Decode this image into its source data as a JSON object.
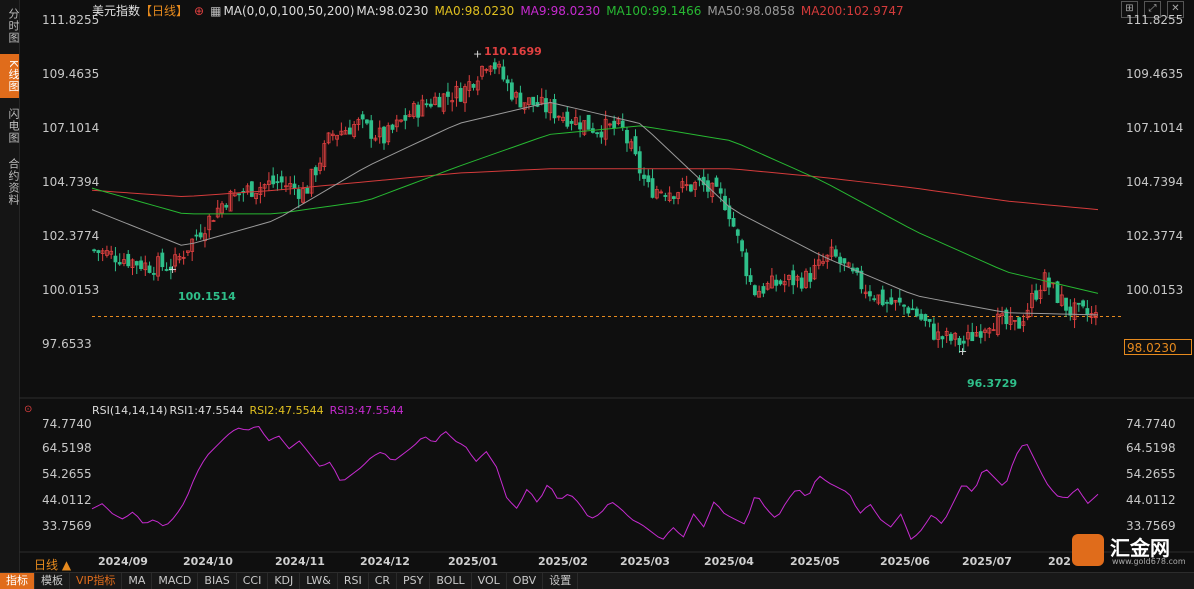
{
  "side_tabs": [
    "分时图",
    "K线图",
    "闪电图",
    "合约资料"
  ],
  "active_tab": 1,
  "header": {
    "name": "美元指数",
    "period": "【日线】",
    "ma_settings": "MA(0,0,0,100,50,200)",
    "ma_value": "MA:98.0230",
    "ma0": "MA0:98.0230",
    "ma9": "MA9:98.0230",
    "ma100": "MA100:99.1466",
    "ma50": "MA50:98.0858",
    "ma200": "MA200:102.9747"
  },
  "colors": {
    "up": "#e04040",
    "down": "#2fbf8a",
    "ma50": "#9a9a9a",
    "ma100": "#27b832",
    "ma200": "#d43b3b",
    "rsi": "#c72bd0",
    "accent": "#e68a1e"
  },
  "price_axis": [
    "111.8255",
    "109.4635",
    "107.1014",
    "104.7394",
    "102.3774",
    "100.0153",
    "97.6533"
  ],
  "current_price": "98.0230",
  "annotations": {
    "high": "110.1699",
    "low1": "100.1514",
    "low2": "96.3729"
  },
  "rsi": {
    "legend": "RSI(14,14,14)",
    "rsi1": "RSI1:47.5544",
    "rsi2": "RSI2:47.5544",
    "rsi3": "RSI3:47.5544",
    "axis": [
      "74.7740",
      "64.5198",
      "54.2655",
      "44.0112",
      "33.7569"
    ]
  },
  "x_axis": [
    "2024/09",
    "2024/10",
    "2024/11",
    "2024/12",
    "2025/01",
    "2025/02",
    "2025/03",
    "2025/04",
    "2025/05",
    "2025/06",
    "2025/07",
    "202"
  ],
  "period_label": "日线",
  "bottom_tabs": [
    "指标",
    "模板",
    "VIP指标",
    "MA",
    "MACD",
    "BIAS",
    "CCI",
    "KDJ",
    "LW&",
    "RSI",
    "CR",
    "PSY",
    "BOLL",
    "VOL",
    "OBV",
    "设置"
  ],
  "logo": {
    "name": "汇金网",
    "url": "www.gold678.com"
  },
  "chart_data": {
    "type": "candlestick",
    "title": "美元指数",
    "ylim": [
      96.0,
      111.8255
    ],
    "close_path": [
      {
        "x": "2024/09",
        "y": 101.1
      },
      {
        "x": "2024/09",
        "y": 100.8
      },
      {
        "x": "2024/09",
        "y": 100.4
      },
      {
        "x": "2024/10",
        "y": 100.4
      },
      {
        "x": "2024/10",
        "y": 102.0
      },
      {
        "x": "2024/10",
        "y": 103.5
      },
      {
        "x": "2024/10",
        "y": 104.0
      },
      {
        "x": "2024/11",
        "y": 104.3
      },
      {
        "x": "2024/11",
        "y": 103.8
      },
      {
        "x": "2024/11",
        "y": 106.5
      },
      {
        "x": "2024/11",
        "y": 107.0
      },
      {
        "x": "2024/12",
        "y": 106.3
      },
      {
        "x": "2024/12",
        "y": 107.5
      },
      {
        "x": "2024/12",
        "y": 108.2
      },
      {
        "x": "2025/01",
        "y": 108.5
      },
      {
        "x": "2025/01",
        "y": 110.1
      },
      {
        "x": "2025/01",
        "y": 108.2
      },
      {
        "x": "2025/02",
        "y": 107.8
      },
      {
        "x": "2025/02",
        "y": 107.3
      },
      {
        "x": "2025/02",
        "y": 106.8
      },
      {
        "x": "2025/03",
        "y": 106.8
      },
      {
        "x": "2025/03",
        "y": 104.0
      },
      {
        "x": "2025/03",
        "y": 103.9
      },
      {
        "x": "2025/03",
        "y": 104.2
      },
      {
        "x": "2025/04",
        "y": 103.3
      },
      {
        "x": "2025/04",
        "y": 99.2
      },
      {
        "x": "2025/04",
        "y": 99.6
      },
      {
        "x": "2025/05",
        "y": 99.8
      },
      {
        "x": "2025/05",
        "y": 100.9
      },
      {
        "x": "2025/05",
        "y": 99.6
      },
      {
        "x": "2025/06",
        "y": 98.7
      },
      {
        "x": "2025/06",
        "y": 98.4
      },
      {
        "x": "2025/06",
        "y": 97.1
      },
      {
        "x": "2025/07",
        "y": 96.8
      },
      {
        "x": "2025/07",
        "y": 97.9
      },
      {
        "x": "2025/07",
        "y": 97.5
      },
      {
        "x": "2025/08",
        "y": 99.8
      },
      {
        "x": "2025/08",
        "y": 98.3
      },
      {
        "x": "2025/08",
        "y": 98.0
      }
    ],
    "ma50": [
      {
        "x": "2024/09",
        "y": 103.0
      },
      {
        "x": "2024/10",
        "y": 101.3
      },
      {
        "x": "2024/11",
        "y": 102.5
      },
      {
        "x": "2024/12",
        "y": 105.0
      },
      {
        "x": "2025/01",
        "y": 107.0
      },
      {
        "x": "2025/02",
        "y": 108.0
      },
      {
        "x": "2025/03",
        "y": 107.0
      },
      {
        "x": "2025/04",
        "y": 103.0
      },
      {
        "x": "2025/05",
        "y": 100.8
      },
      {
        "x": "2025/06",
        "y": 99.0
      },
      {
        "x": "2025/07",
        "y": 98.2
      },
      {
        "x": "2025/08",
        "y": 98.1
      }
    ],
    "ma100": [
      {
        "x": "2024/09",
        "y": 104.0
      },
      {
        "x": "2024/10",
        "y": 102.8
      },
      {
        "x": "2024/11",
        "y": 102.8
      },
      {
        "x": "2024/12",
        "y": 103.4
      },
      {
        "x": "2025/01",
        "y": 105.0
      },
      {
        "x": "2025/02",
        "y": 106.5
      },
      {
        "x": "2025/03",
        "y": 106.9
      },
      {
        "x": "2025/04",
        "y": 106.2
      },
      {
        "x": "2025/05",
        "y": 104.3
      },
      {
        "x": "2025/06",
        "y": 102.0
      },
      {
        "x": "2025/07",
        "y": 100.1
      },
      {
        "x": "2025/08",
        "y": 99.1
      }
    ],
    "ma200": [
      {
        "x": "2024/09",
        "y": 103.9
      },
      {
        "x": "2024/10",
        "y": 103.6
      },
      {
        "x": "2024/11",
        "y": 103.9
      },
      {
        "x": "2024/12",
        "y": 104.3
      },
      {
        "x": "2025/01",
        "y": 104.7
      },
      {
        "x": "2025/02",
        "y": 104.9
      },
      {
        "x": "2025/03",
        "y": 104.9
      },
      {
        "x": "2025/04",
        "y": 104.9
      },
      {
        "x": "2025/05",
        "y": 104.5
      },
      {
        "x": "2025/06",
        "y": 104.0
      },
      {
        "x": "2025/07",
        "y": 103.4
      },
      {
        "x": "2025/08",
        "y": 103.0
      }
    ],
    "rsi_values": [
      42,
      44,
      40,
      38,
      41,
      36,
      38,
      35,
      39,
      45,
      55,
      62,
      66,
      70,
      73,
      72,
      74,
      68,
      70,
      65,
      68,
      63,
      58,
      60,
      52,
      55,
      58,
      62,
      64,
      60,
      63,
      66,
      70,
      67,
      72,
      68,
      66,
      60,
      64,
      58,
      46,
      42,
      50,
      44,
      52,
      45,
      48,
      44,
      38,
      40,
      45,
      42,
      38,
      36,
      33,
      30,
      35,
      31,
      40,
      35,
      45,
      40,
      38,
      36,
      48,
      42,
      38,
      45,
      50,
      46,
      55,
      52,
      50,
      48,
      40,
      44,
      38,
      35,
      40,
      30,
      34,
      40,
      36,
      44,
      52,
      48,
      58,
      54,
      50,
      62,
      68,
      60,
      52,
      47,
      46,
      50,
      44,
      47.5544
    ],
    "rsi_ylim": [
      27,
      76
    ]
  }
}
